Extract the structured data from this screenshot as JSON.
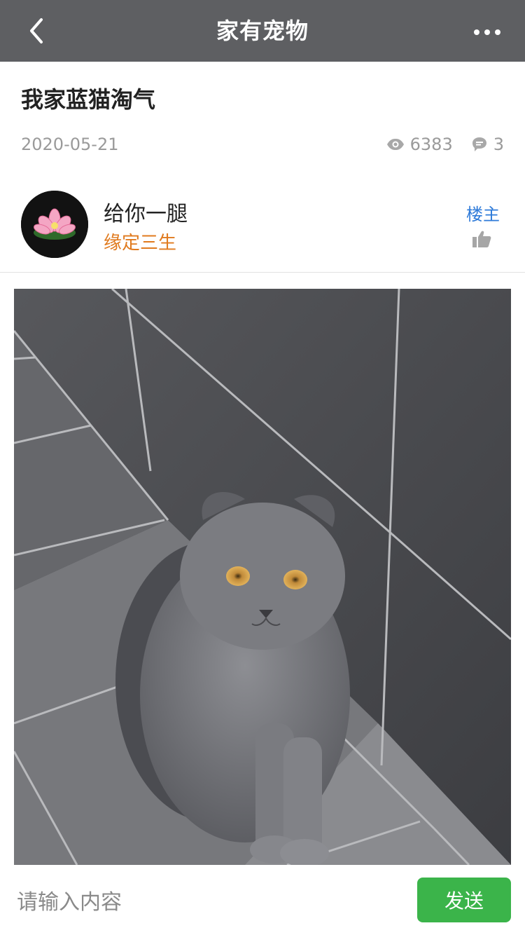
{
  "navbar": {
    "title": "家有宠物",
    "back_icon": "chevron-left-icon",
    "more_icon": "more-dots-icon"
  },
  "post": {
    "title": "我家蓝猫淘气",
    "date": "2020-05-21",
    "views": "6383",
    "comments": "3"
  },
  "author": {
    "name": "给你一腿",
    "tag": "缘定三生",
    "badge": "楼主",
    "like_icon": "thumbs-up-icon"
  },
  "comment_bar": {
    "placeholder": "请输入内容",
    "send_label": "发送"
  },
  "colors": {
    "navbar_bg": "#5e5f62",
    "accent_green": "#3bb44a",
    "tag_orange": "#e07a1e",
    "badge_blue": "#2f7bd9"
  }
}
